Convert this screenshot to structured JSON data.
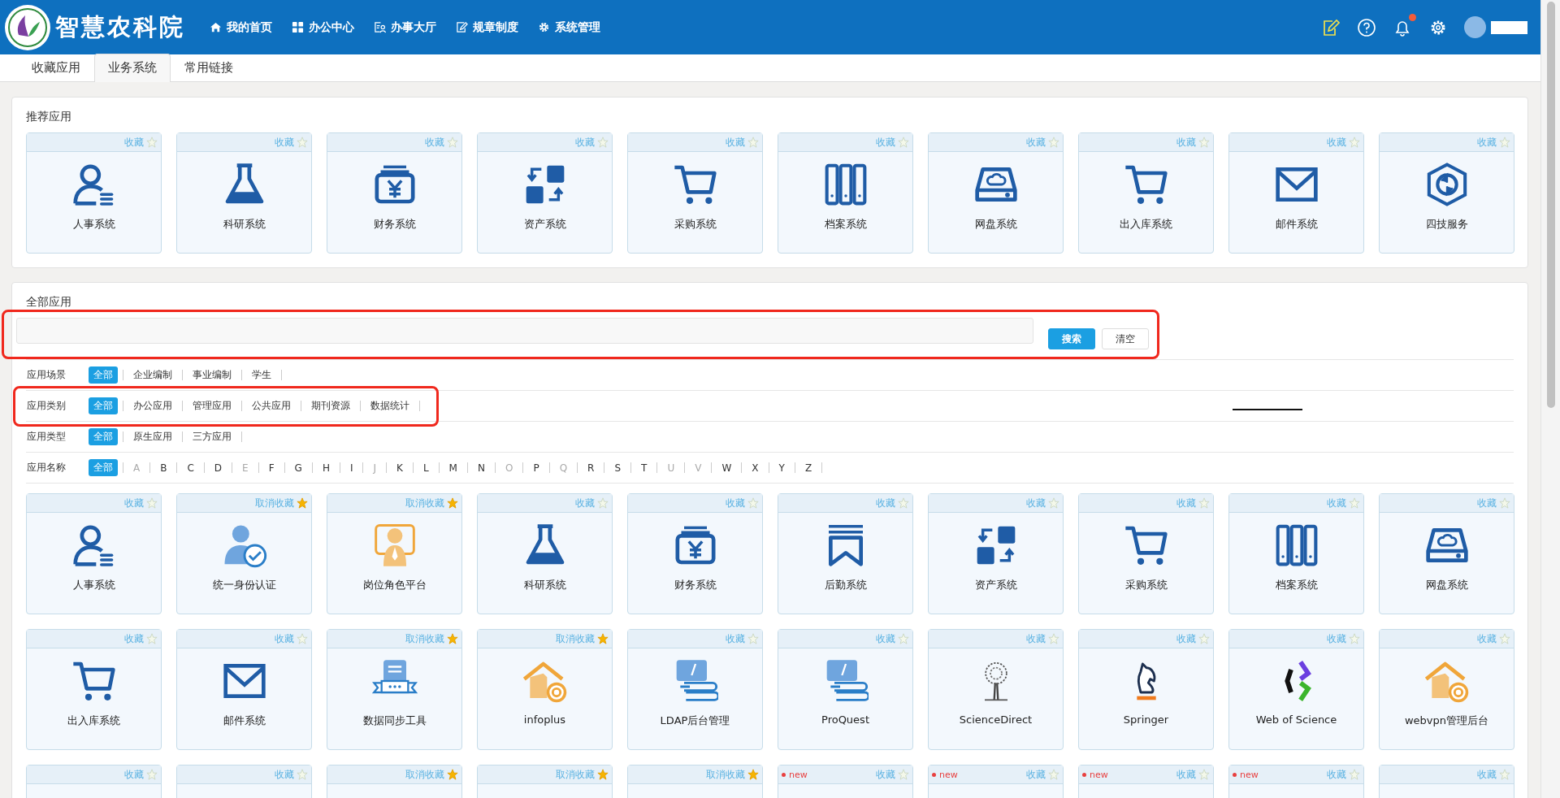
{
  "header": {
    "title": "智慧农科院",
    "nav": [
      {
        "label": "我的首页",
        "kind": "home"
      },
      {
        "label": "办公中心",
        "kind": "grid"
      },
      {
        "label": "办事大厅",
        "kind": "hall"
      },
      {
        "label": "规章制度",
        "kind": "rules"
      },
      {
        "label": "系统管理",
        "kind": "gear"
      }
    ],
    "notification_dot": true
  },
  "tabs": [
    {
      "label": "收藏应用",
      "selected": false
    },
    {
      "label": "业务系统",
      "selected": true
    },
    {
      "label": "常用链接",
      "selected": false
    }
  ],
  "recommended": {
    "title": "推荐应用",
    "apps": [
      {
        "name": "人事系统",
        "kind": "person",
        "fav_label": "收藏",
        "favorited": false
      },
      {
        "name": "科研系统",
        "kind": "flask",
        "fav_label": "收藏",
        "favorited": false
      },
      {
        "name": "财务系统",
        "kind": "money",
        "fav_label": "收藏",
        "favorited": false
      },
      {
        "name": "资产系统",
        "kind": "assets",
        "fav_label": "收藏",
        "favorited": false
      },
      {
        "name": "采购系统",
        "kind": "cart",
        "fav_label": "收藏",
        "favorited": false
      },
      {
        "name": "档案系统",
        "kind": "archive",
        "fav_label": "收藏",
        "favorited": false
      },
      {
        "name": "网盘系统",
        "kind": "disk",
        "fav_label": "收藏",
        "favorited": false
      },
      {
        "name": "出入库系统",
        "kind": "cart",
        "fav_label": "收藏",
        "favorited": false
      },
      {
        "name": "邮件系统",
        "kind": "mail",
        "fav_label": "收藏",
        "favorited": false
      },
      {
        "name": "四技服务",
        "kind": "service",
        "fav_label": "收藏",
        "favorited": false
      }
    ]
  },
  "all_apps": {
    "title": "全部应用",
    "search": {
      "highlighted": true,
      "buttons": [
        "搜索",
        "清空"
      ]
    },
    "filters": [
      {
        "label": "应用场景",
        "highlighted": false,
        "options": [
          {
            "label": "全部",
            "selected": true
          },
          {
            "label": "企业编制",
            "selected": false
          },
          {
            "label": "事业编制",
            "selected": false
          },
          {
            "label": "学生",
            "selected": false
          }
        ]
      },
      {
        "label": "应用类别",
        "highlighted": true,
        "options": [
          {
            "label": "全部",
            "selected": true
          },
          {
            "label": "办公应用",
            "selected": false
          },
          {
            "label": "管理应用",
            "selected": false
          },
          {
            "label": "公共应用",
            "selected": false
          },
          {
            "label": "期刊资源",
            "selected": false
          },
          {
            "label": "数据统计",
            "selected": false
          }
        ]
      },
      {
        "label": "应用类型",
        "highlighted": false,
        "options": [
          {
            "label": "全部",
            "selected": true
          },
          {
            "label": "原生应用",
            "selected": false
          },
          {
            "label": "三方应用",
            "selected": false
          }
        ]
      }
    ],
    "name_filter": {
      "label": "应用名称",
      "options": [
        {
          "label": "全部",
          "selected": true,
          "disabled": false
        },
        {
          "label": "A",
          "selected": false,
          "disabled": true
        },
        {
          "label": "B",
          "selected": false,
          "disabled": false
        },
        {
          "label": "C",
          "selected": false,
          "disabled": false
        },
        {
          "label": "D",
          "selected": false,
          "disabled": false
        },
        {
          "label": "E",
          "selected": false,
          "disabled": true
        },
        {
          "label": "F",
          "selected": false,
          "disabled": false
        },
        {
          "label": "G",
          "selected": false,
          "disabled": false
        },
        {
          "label": "H",
          "selected": false,
          "disabled": false
        },
        {
          "label": "I",
          "selected": false,
          "disabled": false
        },
        {
          "label": "J",
          "selected": false,
          "disabled": true
        },
        {
          "label": "K",
          "selected": false,
          "disabled": false
        },
        {
          "label": "L",
          "selected": false,
          "disabled": false
        },
        {
          "label": "M",
          "selected": false,
          "disabled": false
        },
        {
          "label": "N",
          "selected": false,
          "disabled": false
        },
        {
          "label": "O",
          "selected": false,
          "disabled": true
        },
        {
          "label": "P",
          "selected": false,
          "disabled": false
        },
        {
          "label": "Q",
          "selected": false,
          "disabled": true
        },
        {
          "label": "R",
          "selected": false,
          "disabled": false
        },
        {
          "label": "S",
          "selected": false,
          "disabled": false
        },
        {
          "label": "T",
          "selected": false,
          "disabled": false
        },
        {
          "label": "U",
          "selected": false,
          "disabled": true
        },
        {
          "label": "V",
          "selected": false,
          "disabled": true
        },
        {
          "label": "W",
          "selected": false,
          "disabled": false
        },
        {
          "label": "X",
          "selected": false,
          "disabled": false
        },
        {
          "label": "Y",
          "selected": false,
          "disabled": false
        },
        {
          "label": "Z",
          "selected": false,
          "disabled": false
        }
      ]
    },
    "apps": [
      {
        "name": "人事系统",
        "kind": "person",
        "fav_label": "收藏",
        "favorited": false
      },
      {
        "name": "统一身份认证",
        "kind": "idcheck",
        "fav_label": "取消收藏",
        "favorited": true
      },
      {
        "name": "岗位角色平台",
        "kind": "role",
        "fav_label": "取消收藏",
        "favorited": true
      },
      {
        "name": "科研系统",
        "kind": "flask",
        "fav_label": "收藏",
        "favorited": false
      },
      {
        "name": "财务系统",
        "kind": "money",
        "fav_label": "收藏",
        "favorited": false
      },
      {
        "name": "后勤系统",
        "kind": "bookmark",
        "fav_label": "收藏",
        "favorited": false
      },
      {
        "name": "资产系统",
        "kind": "assets",
        "fav_label": "收藏",
        "favorited": false
      },
      {
        "name": "采购系统",
        "kind": "cart",
        "fav_label": "收藏",
        "favorited": false
      },
      {
        "name": "档案系统",
        "kind": "archive",
        "fav_label": "收藏",
        "favorited": false
      },
      {
        "name": "网盘系统",
        "kind": "disk",
        "fav_label": "收藏",
        "favorited": false
      },
      {
        "name": "出入库系统",
        "kind": "cart",
        "fav_label": "收藏",
        "favorited": false
      },
      {
        "name": "邮件系统",
        "kind": "mail",
        "fav_label": "收藏",
        "favorited": false
      },
      {
        "name": "数据同步工具",
        "kind": "sync",
        "fav_label": "取消收藏",
        "favorited": true
      },
      {
        "name": "infoplus",
        "kind": "housegear",
        "fav_label": "取消收藏",
        "favorited": true
      },
      {
        "name": "LDAP后台管理",
        "kind": "computer",
        "fav_label": "收藏",
        "favorited": false
      },
      {
        "name": "ProQuest",
        "kind": "computer",
        "fav_label": "收藏",
        "favorited": false
      },
      {
        "name": "ScienceDirect",
        "kind": "tree",
        "fav_label": "收藏",
        "favorited": false
      },
      {
        "name": "Springer",
        "kind": "horse",
        "fav_label": "收藏",
        "favorited": false
      },
      {
        "name": "Web of Science",
        "kind": "wos",
        "fav_label": "收藏",
        "favorited": false
      },
      {
        "name": "webvpn管理后台",
        "kind": "housegear",
        "fav_label": "收藏",
        "favorited": false
      },
      {
        "fav_label": "收藏",
        "favorited": false
      },
      {
        "fav_label": "收藏",
        "favorited": false
      },
      {
        "fav_label": "取消收藏",
        "favorited": true
      },
      {
        "fav_label": "取消收藏",
        "favorited": true
      },
      {
        "fav_label": "取消收藏",
        "favorited": true
      },
      {
        "fav_label": "收藏",
        "favorited": false,
        "badge": "new"
      },
      {
        "fav_label": "收藏",
        "favorited": false,
        "badge": "new"
      },
      {
        "fav_label": "收藏",
        "favorited": false,
        "badge": "new"
      },
      {
        "fav_label": "收藏",
        "favorited": false,
        "badge": "new"
      },
      {
        "fav_label": "收藏",
        "favorited": false
      }
    ]
  }
}
